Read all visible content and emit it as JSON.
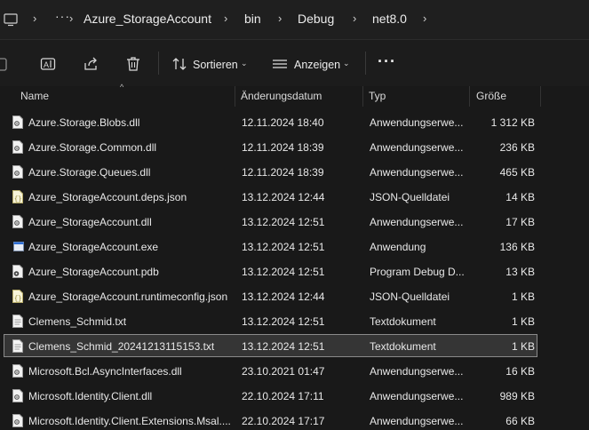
{
  "breadcrumb": {
    "more": "···",
    "items": [
      "Azure_StorageAccount",
      "bin",
      "Debug",
      "net8.0"
    ]
  },
  "toolbar": {
    "sort_label": "Sortieren",
    "view_label": "Anzeigen",
    "more_label": "···"
  },
  "columns": {
    "name": "Name",
    "date": "Änderungsdatum",
    "type": "Typ",
    "size": "Größe"
  },
  "files": [
    {
      "name": "Azure.Storage.Blobs.dll",
      "date": "12.11.2024 18:40",
      "type": "Anwendungserwe...",
      "size": "1 312 KB",
      "icon": "dll-file-icon"
    },
    {
      "name": "Azure.Storage.Common.dll",
      "date": "12.11.2024 18:39",
      "type": "Anwendungserwe...",
      "size": "236 KB",
      "icon": "dll-file-icon"
    },
    {
      "name": "Azure.Storage.Queues.dll",
      "date": "12.11.2024 18:39",
      "type": "Anwendungserwe...",
      "size": "465 KB",
      "icon": "dll-file-icon"
    },
    {
      "name": "Azure_StorageAccount.deps.json",
      "date": "13.12.2024 12:44",
      "type": "JSON-Quelldatei",
      "size": "14 KB",
      "icon": "json-file-icon"
    },
    {
      "name": "Azure_StorageAccount.dll",
      "date": "13.12.2024 12:51",
      "type": "Anwendungserwe...",
      "size": "17 KB",
      "icon": "dll-file-icon"
    },
    {
      "name": "Azure_StorageAccount.exe",
      "date": "13.12.2024 12:51",
      "type": "Anwendung",
      "size": "136 KB",
      "icon": "exe-file-icon"
    },
    {
      "name": "Azure_StorageAccount.pdb",
      "date": "13.12.2024 12:51",
      "type": "Program Debug D...",
      "size": "13 KB",
      "icon": "pdb-file-icon"
    },
    {
      "name": "Azure_StorageAccount.runtimeconfig.json",
      "date": "13.12.2024 12:44",
      "type": "JSON-Quelldatei",
      "size": "1 KB",
      "icon": "json-file-icon"
    },
    {
      "name": "Clemens_Schmid.txt",
      "date": "13.12.2024 12:51",
      "type": "Textdokument",
      "size": "1 KB",
      "icon": "text-file-icon"
    },
    {
      "name": "Clemens_Schmid_20241213115153.txt",
      "date": "13.12.2024 12:51",
      "type": "Textdokument",
      "size": "1 KB",
      "icon": "text-file-icon",
      "selected": true
    },
    {
      "name": "Microsoft.Bcl.AsyncInterfaces.dll",
      "date": "23.10.2021 01:47",
      "type": "Anwendungserwe...",
      "size": "16 KB",
      "icon": "dll-file-icon"
    },
    {
      "name": "Microsoft.Identity.Client.dll",
      "date": "22.10.2024 17:11",
      "type": "Anwendungserwe...",
      "size": "989 KB",
      "icon": "dll-file-icon"
    },
    {
      "name": "Microsoft.Identity.Client.Extensions.Msal....",
      "date": "22.10.2024 17:17",
      "type": "Anwendungserwe...",
      "size": "66 KB",
      "icon": "dll-file-icon"
    }
  ]
}
